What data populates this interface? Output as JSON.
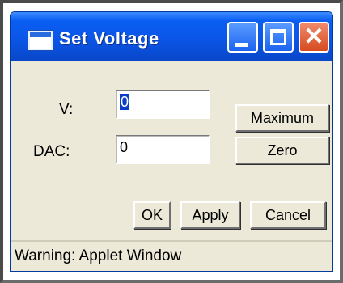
{
  "window": {
    "title": "Set Voltage",
    "controls": [
      "minimize-icon",
      "maximize-icon",
      "close-icon"
    ],
    "close_glyph": "✕"
  },
  "form": {
    "v_label": "V:",
    "v_value": "0",
    "dac_label": "DAC:",
    "dac_value": "0"
  },
  "buttons": {
    "maximum": "Maximum",
    "zero": "Zero",
    "ok": "OK",
    "apply": "Apply",
    "cancel": "Cancel"
  },
  "status": {
    "text": "Warning: Applet Window"
  },
  "colors": {
    "titlebar": "#0b56e8",
    "close_button": "#d84a1f",
    "window_background": "#ece9d8"
  }
}
